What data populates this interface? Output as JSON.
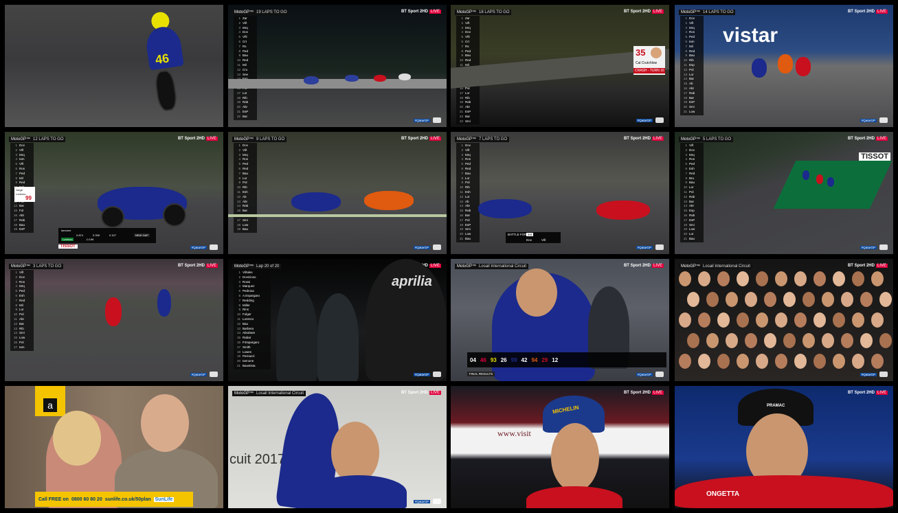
{
  "header": {
    "series": "MotoGP™",
    "broadcaster": "BT Sport",
    "channel": "2HD",
    "live": "LIVE",
    "hashtag": "#QatarGP"
  },
  "tiles": {
    "t2": {
      "lap": "19 LAPS TO GO",
      "riders": [
        "Zar",
        "Viñ",
        "Mrq",
        "Dov",
        "Vñl",
        "Crt",
        "Rs",
        "Ped",
        "Bau",
        "Red",
        "Mil",
        "Cru",
        "Sne",
        "Esp",
        "Ab",
        "Pol",
        "Lor",
        "Rib",
        "Rab",
        "Abr",
        "EsP",
        "Bar"
      ]
    },
    "t3": {
      "lap": "18 LAPS TO GO",
      "number": "35",
      "rider": "Cal Crutchlow",
      "status": "CRASH - TURN 16",
      "riders": [
        "Zar",
        "Viñ",
        "Mrq",
        "Dov",
        "Vñl",
        "Crt",
        "Rs",
        "Ped",
        "Bau",
        "Red",
        "Mil",
        "Cru",
        "Sne",
        "Esp",
        "Ab",
        "Pol",
        "Lor",
        "Rib",
        "Rab",
        "Abr",
        "EsP",
        "Bar",
        "Smi"
      ]
    },
    "t4": {
      "lap": "14 LAPS TO GO",
      "sponsor": "vistar",
      "riders": [
        "Dov",
        "Viñ",
        "Mrq",
        "Ros",
        "Ped",
        "Iam",
        "Mil",
        "Red",
        "Bau",
        "Rib",
        "Esp",
        "Pol",
        "Lor",
        "Bar",
        "Ab",
        "Abr",
        "Rab",
        "Bar",
        "EsP",
        "Smi",
        "Low"
      ]
    },
    "t5": {
      "lap": "12 LAPS TO GO",
      "rider_first": "Jorge",
      "rider_last": "Lorenzo",
      "number": "99",
      "sector": "S",
      "sector_name": "Iannone",
      "gaps": [
        "0.874",
        "0.395",
        "0.107"
      ],
      "sector_label": "NEW GAP",
      "sponsor": "TISSOT",
      "gap_rider": "Lorenzo",
      "gap_value": "-0.196",
      "riders": [
        "Dov",
        "Viñ",
        "Mrq",
        "Iam",
        "Viñ",
        "Ros",
        "Ped",
        "Mil",
        "Red",
        "Esh",
        "Lor",
        "Iam",
        "Pol",
        "Bar",
        "Fol",
        "Abt",
        "Rab",
        "Bau",
        "EsP"
      ]
    },
    "t6": {
      "lap": "9 LAPS TO GO",
      "riders": [
        "Dov",
        "Viñ",
        "Mrq",
        "Ros",
        "Ped",
        "Red",
        "Bau",
        "Lor",
        "Pol",
        "Rib",
        "Esh",
        "Ab",
        "Abr",
        "Rab",
        "Bar",
        "EsP",
        "Smi",
        "Low",
        "Bau"
      ]
    },
    "t7": {
      "lap": "7 LAPS TO GO",
      "battle": "BATTLE FOR",
      "position": "1st",
      "battle_riders": [
        "Dov",
        "Viñ"
      ],
      "riders": [
        "Dov",
        "Viñ",
        "Mrq",
        "Ros",
        "Ped",
        "Red",
        "Bau",
        "Lor",
        "Pol",
        "Rib",
        "Esh",
        "Lor",
        "Ab",
        "Abr",
        "Rab",
        "Bar",
        "Pol",
        "EsP",
        "Smi",
        "Low",
        "Bau"
      ]
    },
    "t8": {
      "lap": "5 LAPS TO GO",
      "sponsor": "TISSOT",
      "riders": [
        "Viñ",
        "Dov",
        "Mrq",
        "Ros",
        "Ped",
        "Esh",
        "Red",
        "Bru",
        "Bau",
        "Lor",
        "Pol",
        "Rab",
        "Bar",
        "Abr",
        "Esp",
        "Rab",
        "EsP",
        "Smi",
        "Low",
        "Lor",
        "Bau"
      ]
    },
    "t9": {
      "lap": "3 LAPS TO GO",
      "riders": [
        "Viñ",
        "Dov",
        "Ros",
        "Mrq",
        "Ped",
        "Esh",
        "Red",
        "Mil",
        "Lor",
        "Pol",
        "Abr",
        "Bar",
        "Rib",
        "Smi",
        "Low",
        "Pol",
        "Iam"
      ]
    },
    "t10": {
      "lap": "Lap 20 of 20",
      "riders": [
        "Viñales",
        "Dovizioso",
        "Rossi",
        "Marquez",
        "Pedrosa",
        "A.Espargaro",
        "Redding",
        "Miller",
        "Rins",
        "Folger",
        "Lorenzo",
        "Bau",
        "Barbera",
        "Abraham",
        "Rabat",
        "P.Espargaro",
        "Smith",
        "Lowes",
        "Pernazzi",
        "Iannone",
        "Baustista"
      ]
    },
    "t11": {
      "circuit": "Losail International Circuit",
      "label": "FINAL RESULTS",
      "results": [
        "04",
        "46",
        "93",
        "26",
        "99",
        "42",
        "94",
        "29",
        "12"
      ]
    },
    "t12": {
      "circuit": "Losail International Circuit"
    },
    "t13": {
      "phone": "0800 60 80 20",
      "url": "sunlife.co.uk/50plan",
      "call_label": "Call FREE on",
      "brand": "SunLife",
      "logo": "a"
    },
    "t14": {
      "circuit": "Losail International Circuit",
      "backdrop": "cuit 2017"
    },
    "t15": {
      "backdrop": "www.visit",
      "sponsor": "MICHELIN"
    },
    "t16": {
      "sponsor": "PRAMAC",
      "sponsor2": "ONGETTA"
    }
  },
  "colors": {
    "yamaha": "#1b2a8c",
    "ducati": "#c8101e",
    "honda": "#e05a10",
    "live": "#e0003c",
    "sunlife": "#f5c400"
  }
}
